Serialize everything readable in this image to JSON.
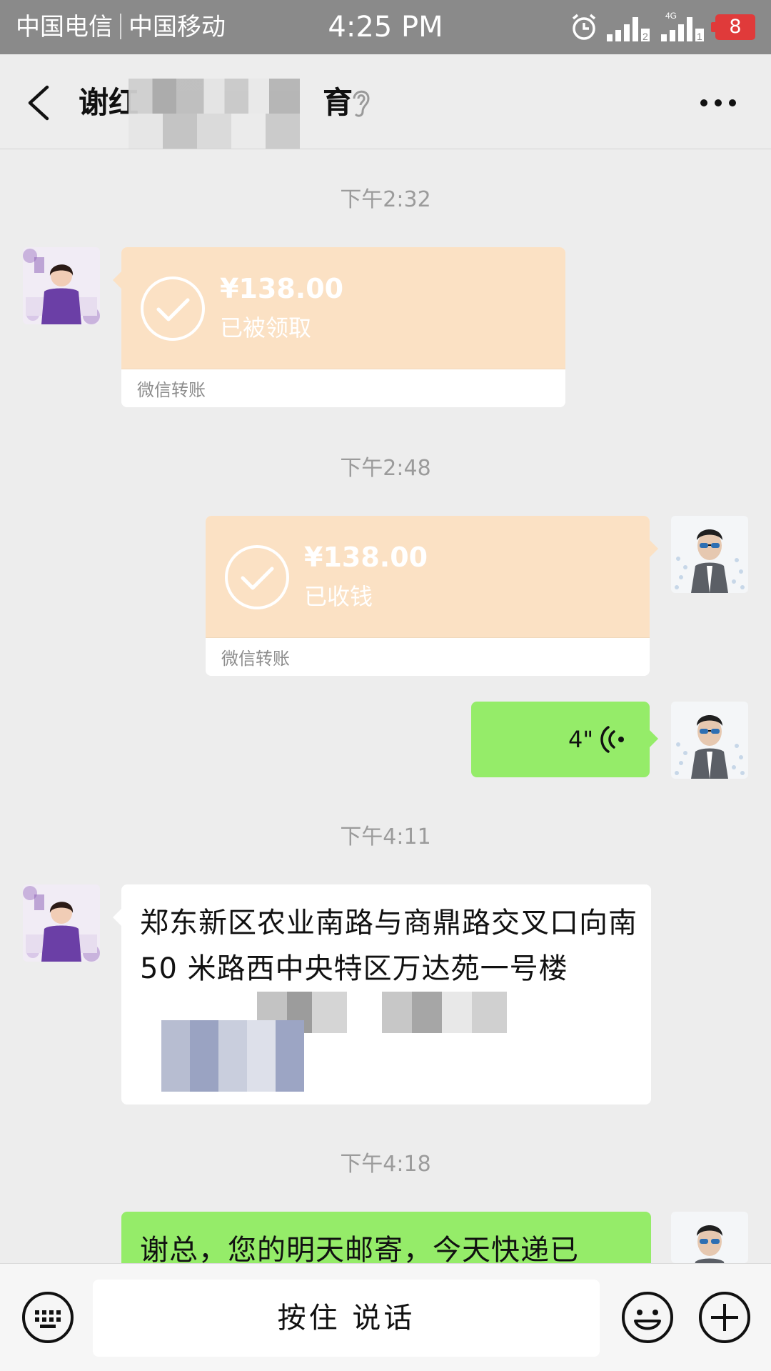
{
  "status_bar": {
    "carrier1": "中国电信",
    "carrier2": "中国移动",
    "time": "4:25 PM",
    "battery": "8"
  },
  "header": {
    "title_left": "谢红",
    "title_right": "育"
  },
  "messages": [
    {
      "timestamp": "下午2:32"
    },
    {
      "amount": "¥138.00",
      "status": "已被领取",
      "footer": "微信转账"
    },
    {
      "timestamp": "下午2:48"
    },
    {
      "amount": "¥138.00",
      "status": "已收钱",
      "footer": "微信转账"
    },
    {
      "duration": "4\""
    },
    {
      "timestamp": "下午4:11"
    },
    {
      "text": "郑东新区农业南路与商鼎路交叉口向南 50 米路西中央特区万达苑一号楼"
    },
    {
      "timestamp": "下午4:18"
    },
    {
      "text": "谢总，您的明天邮寄，今天快递已"
    }
  ],
  "input": {
    "hold_to_talk": "按住 说话"
  },
  "colors": {
    "status_bar": "#8a8a8a",
    "background": "#ededed",
    "transfer_card": "#fbe1c4",
    "sent_bubble": "#95ec69",
    "battery": "#e03a3a"
  },
  "icons": [
    "back-icon",
    "ear-icon",
    "more-icon",
    "check-icon",
    "voice-wave-icon",
    "keyboard-icon",
    "emoji-icon",
    "plus-icon",
    "alarm-icon",
    "signal-icon"
  ]
}
